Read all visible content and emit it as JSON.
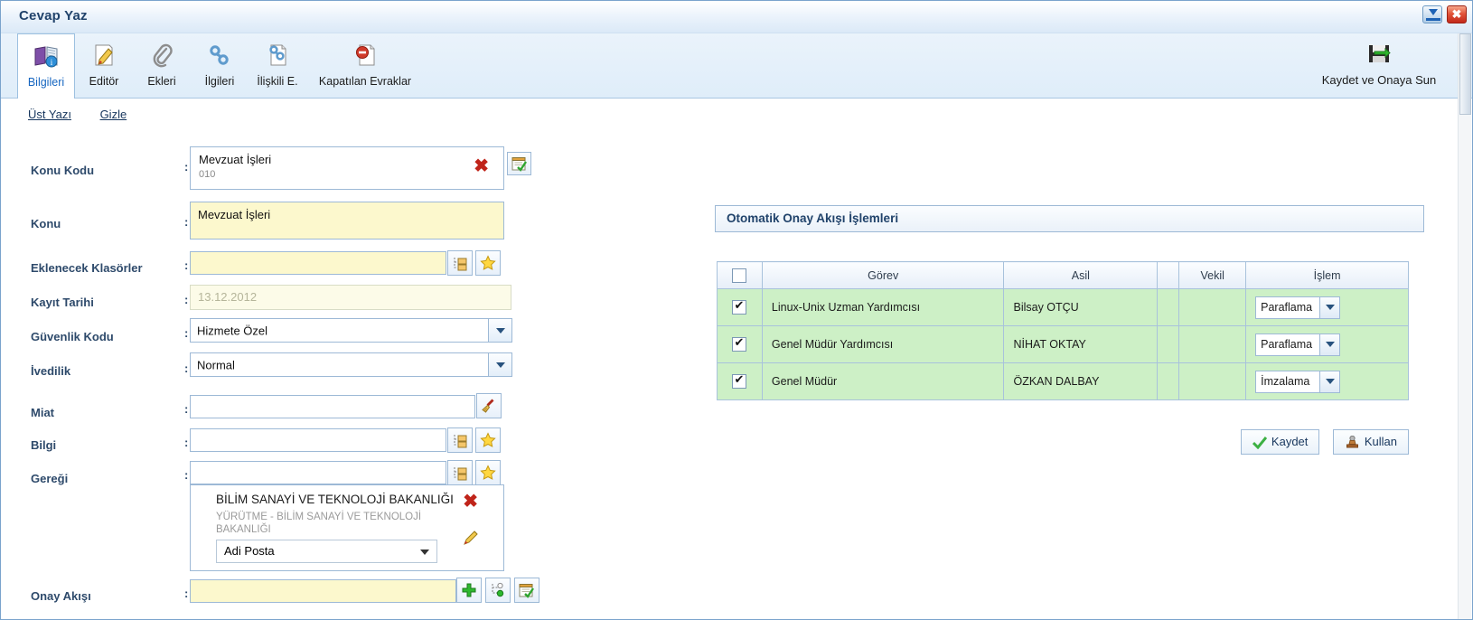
{
  "window": {
    "title": "Cevap Yaz",
    "minimize_label": "minimize",
    "close_label": "✖"
  },
  "ribbon": {
    "tabs": [
      {
        "label": "Bilgileri",
        "icon": "book-info-icon",
        "active": true
      },
      {
        "label": "Editör",
        "icon": "pencil-document-icon",
        "active": false
      },
      {
        "label": "Ekleri",
        "icon": "paperclip-icon",
        "active": false
      },
      {
        "label": "İlgileri",
        "icon": "chain-link-icon",
        "active": false
      },
      {
        "label": "İlişkili E.",
        "icon": "linked-document-icon",
        "active": false
      },
      {
        "label": "Kapatılan Evraklar",
        "icon": "no-entry-document-icon",
        "active": false
      }
    ],
    "save_and_submit": {
      "label": "Kaydet ve Onaya Sun",
      "icon": "save-submit-icon"
    }
  },
  "links": [
    {
      "label": "Üst Yazı"
    },
    {
      "label": "Gizle"
    }
  ],
  "form": {
    "konu_kodu": {
      "label": "Konu Kodu",
      "value": "Mevzuat İşleri",
      "code": "010",
      "clear_icon": "red-x-icon",
      "picker_icon": "select-list-icon"
    },
    "konu": {
      "label": "Konu",
      "value": "Mevzuat İşleri"
    },
    "eklenecek_klasorler": {
      "label": "Eklenecek Klasörler",
      "value": "",
      "tree_icon": "folder-tree-icon",
      "star_icon": "favorite-star-icon"
    },
    "kayit_tarihi": {
      "label": "Kayıt Tarihi",
      "value": "13.12.2012"
    },
    "guvenlik_kodu": {
      "label": "Güvenlik Kodu",
      "value": "Hizmete Özel"
    },
    "ivedilik": {
      "label": "İvedilik",
      "value": "Normal"
    },
    "miat": {
      "label": "Miat",
      "value": "",
      "broom_icon": "broom-clear-icon"
    },
    "bilgi": {
      "label": "Bilgi",
      "value": "",
      "tree_icon": "folder-tree-icon",
      "star_icon": "favorite-star-icon"
    },
    "geregi": {
      "label": "Gereği",
      "value": "",
      "tree_icon": "folder-tree-icon",
      "star_icon": "favorite-star-icon",
      "recipient": {
        "org": "BİLİM SANAYİ VE TEKNOLOJİ BAKANLIĞI",
        "sub": "YÜRÜTME - BİLİM SANAYİ VE TEKNOLOJİ BAKANLIĞI",
        "delivery": "Adi Posta",
        "remove_icon": "red-x-icon",
        "edit_icon": "pencil-edit-icon"
      }
    },
    "onay_akisi": {
      "label": "Onay Akışı",
      "value": "",
      "add_icon": "green-plus-icon",
      "flow_icon": "workflow-node-icon",
      "list_icon": "select-list-icon"
    }
  },
  "right_panel": {
    "header": "Otomatik Onay Akışı İşlemleri",
    "columns": [
      "",
      "Görev",
      "Asil",
      "",
      "Vekil",
      "İşlem"
    ],
    "rows": [
      {
        "checked": true,
        "gorev": "Linux-Unix Uzman Yardımcısı",
        "asil": "Bilsay OTÇU",
        "blank": "",
        "vekil": "",
        "islem": "Paraflama"
      },
      {
        "checked": true,
        "gorev": "Genel Müdür Yardımcısı",
        "asil": "NİHAT OKTAY",
        "blank": "",
        "vekil": "",
        "islem": "Paraflama"
      },
      {
        "checked": true,
        "gorev": "Genel Müdür",
        "asil": "ÖZKAN DALBAY",
        "blank": "",
        "vekil": "",
        "islem": "İmzalama"
      }
    ],
    "buttons": [
      {
        "label": "Kaydet",
        "icon": "green-check-icon"
      },
      {
        "label": "Kullan",
        "icon": "stamp-icon"
      }
    ]
  },
  "colors": {
    "title": "#21436b",
    "accent": "#1565c0",
    "row_green": "#cdf0c6",
    "field_yellow": "#fcf8cd",
    "border": "#9db9d6"
  }
}
